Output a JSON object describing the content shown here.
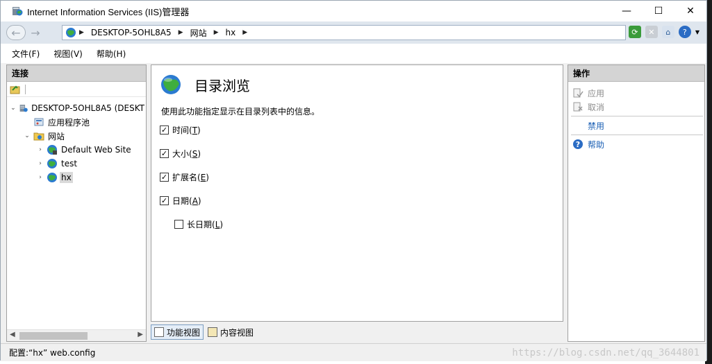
{
  "window": {
    "title": "Internet Information Services (IIS)管理器",
    "controls": {
      "minimize": "—",
      "maximize": "☐",
      "close": "✕"
    }
  },
  "address": {
    "segments": [
      "DESKTOP-5OHL8A5",
      "网站",
      "hx"
    ]
  },
  "menu": {
    "items": [
      "文件(F)",
      "视图(V)",
      "帮助(H)"
    ]
  },
  "connections": {
    "header": "连接",
    "tree": [
      {
        "label": "DESKTOP-5OHL8A5 (DESKT",
        "icon": "server-icon",
        "expander": "⌄"
      },
      {
        "label": "应用程序池",
        "icon": "app-pool-icon",
        "expander": ""
      },
      {
        "label": "网站",
        "icon": "sites-folder-icon",
        "expander": "⌄"
      },
      {
        "label": "Default Web Site",
        "icon": "globe-icon",
        "expander": "›"
      },
      {
        "label": "test",
        "icon": "globe-icon",
        "expander": "›"
      },
      {
        "label": "hx",
        "icon": "globe-icon",
        "expander": "›"
      }
    ]
  },
  "feature": {
    "title": "目录浏览",
    "description": "使用此功能指定显示在目录列表中的信息。",
    "options": [
      {
        "text": "时间(",
        "key": "T",
        "close": ")",
        "checked": "✓"
      },
      {
        "text": "大小(",
        "key": "S",
        "close": ")",
        "checked": "✓"
      },
      {
        "text": "扩展名(",
        "key": "E",
        "close": ")",
        "checked": "✓"
      },
      {
        "text": "日期(",
        "key": "A",
        "close": ")",
        "checked": "✓"
      },
      {
        "text": "长日期(",
        "key": "L",
        "close": ")",
        "checked": ""
      }
    ],
    "tabs": [
      "功能视图",
      "内容视图"
    ]
  },
  "actions": {
    "header": "操作",
    "items": [
      "应用",
      "取消",
      "禁用",
      "帮助"
    ]
  },
  "status": {
    "text": "配置:“hx” web.config"
  },
  "watermark": "https://blog.csdn.net/qq_3644801",
  "colors": {
    "link": "#1a5fb4",
    "disabled": "#8d8d8d",
    "header_bg": "#d4d4d4"
  }
}
